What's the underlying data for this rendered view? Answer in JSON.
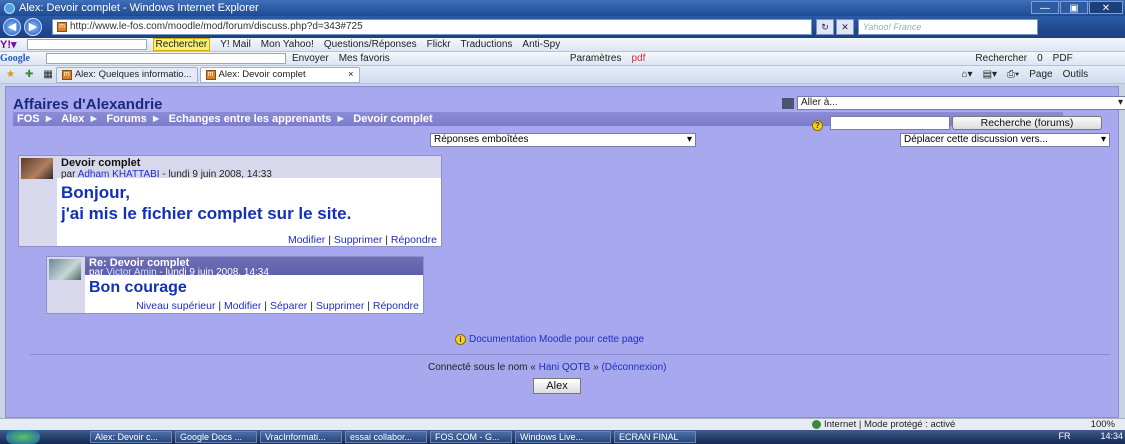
{
  "window": {
    "title": "Alex: Devoir complet - Windows Internet Explorer",
    "buttons": [
      "—",
      "▣",
      "✕"
    ]
  },
  "address": {
    "url": "http://www.le-fos.com/moodle/mod/forum/discuss.php?d=343#725",
    "search_placeholder": "Yahoo! France"
  },
  "yahoo_toolbar": {
    "search_label": "Rechercher",
    "items": [
      "Y! Mail",
      "Mon Yahoo!",
      "Questions/Réponses",
      "Flickr",
      "Traductions",
      "Anti-Spy"
    ]
  },
  "google_toolbar": {
    "logo": "Google",
    "items": [
      "Envoyer",
      "Mes favoris",
      "Paramètres",
      "pdf"
    ],
    "right_items": [
      "Rechercher",
      "0",
      "PDF"
    ]
  },
  "tabs": [
    {
      "label": "Alex: Quelques informatio..."
    },
    {
      "label": "Alex: Devoir complet"
    }
  ],
  "command_bar": [
    "Page",
    "Outils"
  ],
  "site": {
    "title": "Affaires d'Alexandrie",
    "jump_label": "Aller à..."
  },
  "breadcrumb": [
    "FOS",
    "Alex",
    "Forums",
    "Echanges entre les apprenants",
    "Devoir complet"
  ],
  "search": {
    "button_label": "Recherche (forums)"
  },
  "display_mode": "Réponses emboîtées",
  "move_discussion": "Déplacer cette discussion vers...",
  "posts": [
    {
      "subject": "Devoir complet",
      "by_prefix": "par",
      "author": "Adham KHATTABI",
      "date": "- lundi 9 juin 2008, 14:33",
      "lines": [
        "Bonjour,",
        "j'ai mis le fichier complet sur le site."
      ],
      "links": [
        "Modifier",
        "Supprimer",
        "Répondre"
      ]
    },
    {
      "subject": "Re: Devoir complet",
      "by_prefix": "par",
      "author": "Victor Amin",
      "date": "- lundi 9 juin 2008, 14:34",
      "lines": [
        "Bon courage"
      ],
      "links": [
        "Niveau supérieur",
        "Modifier",
        "Séparer",
        "Supprimer",
        "Répondre"
      ]
    }
  ],
  "doc_link": "Documentation Moodle pour cette page",
  "login": {
    "prefix": "Connecté sous le nom «",
    "user": "Hani QOTB",
    "suffix": "»",
    "logout": "(Déconnexion)"
  },
  "course_button": "Alex",
  "status": {
    "zone": "Internet | Mode protégé : activé",
    "zoom": "100%"
  },
  "taskbar": {
    "items": [
      "Alex: Devoir c...",
      "Google Docs ...",
      "VracInformati...",
      "essai collabor...",
      "FOS.COM - G...",
      "Windows Live...",
      "ECRAN FINAL"
    ],
    "lang": "FR",
    "clock": "14:34"
  }
}
